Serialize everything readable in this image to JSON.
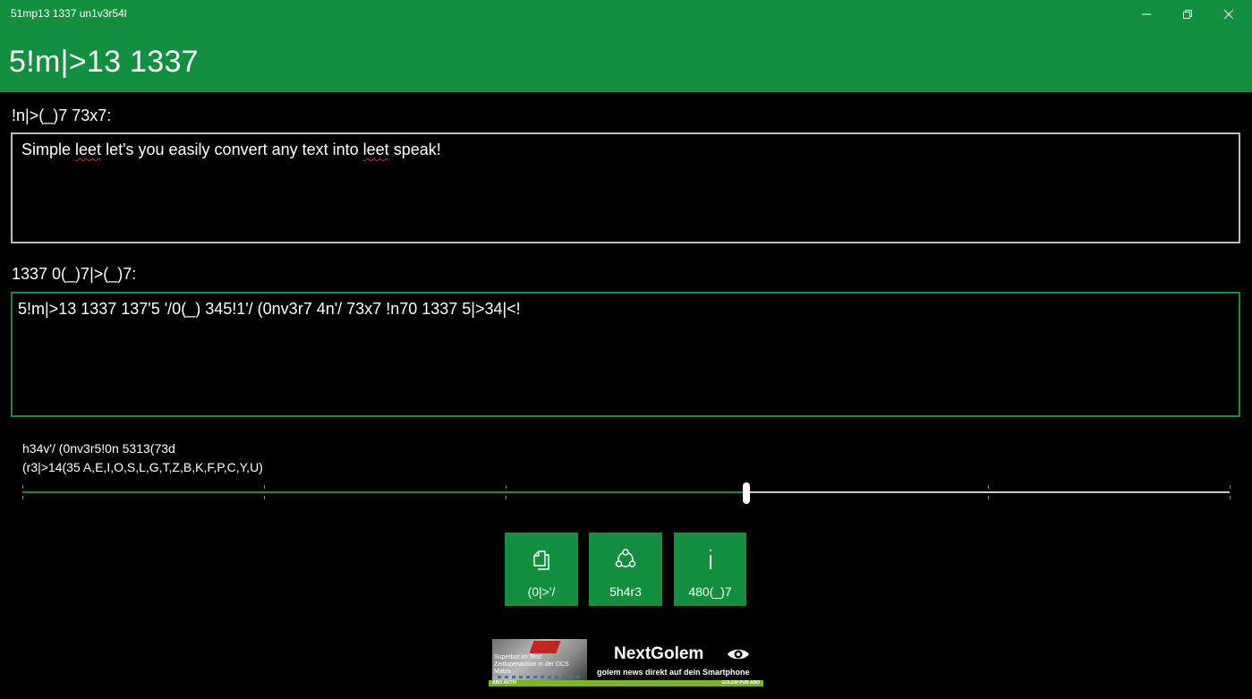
{
  "window": {
    "title": "51mp13 1337 un1v3r54l",
    "minimize_label": "Minimize",
    "restore_label": "Restore",
    "close_label": "Close"
  },
  "header": {
    "app_title": "5!m|>13 1337"
  },
  "input": {
    "label": "!n|>(_)7 73x7:",
    "text_before": "Simple ",
    "text_word1": "leet",
    "text_middle": " let's you easily convert any text into ",
    "text_word2": "leet",
    "text_after": " speak!"
  },
  "output": {
    "label": "1337 0(_)7|>(_)7:",
    "text": "5!m|>13 1337 137'5 '/0(_) 345!1'/ (0nv3r7 4n'/ 73x7 !n70 1337 5|>34|<!"
  },
  "conversion": {
    "heaviness_label": "h34v'/ (0nv3r5!0n 5313(73d",
    "replaces_label": "(r3|>14(35 A,E,I,O,S,L,G,T,Z,B,K,F,P,C,Y,U)",
    "slider_value": 0.6,
    "slider_steps": 5
  },
  "actions": {
    "copy": {
      "label": "(0|>'/",
      "icon": "copy-icon"
    },
    "share": {
      "label": "5h4r3",
      "icon": "share-icon"
    },
    "about": {
      "label": "480(_)7",
      "icon": "info-icon"
    }
  },
  "ad": {
    "brand": "NextGolem",
    "tagline": "golem news direkt auf dein Smartphone",
    "thumb_caption": "Superbot im Test: Zeitlupenaction in der DCS Matrix",
    "bar_left": "ABO AKTIV",
    "bar_right": "GOLEM PUR ABO"
  },
  "colors": {
    "accent": "#138f40",
    "background": "#000000",
    "input_border": "#bdbdbd"
  }
}
